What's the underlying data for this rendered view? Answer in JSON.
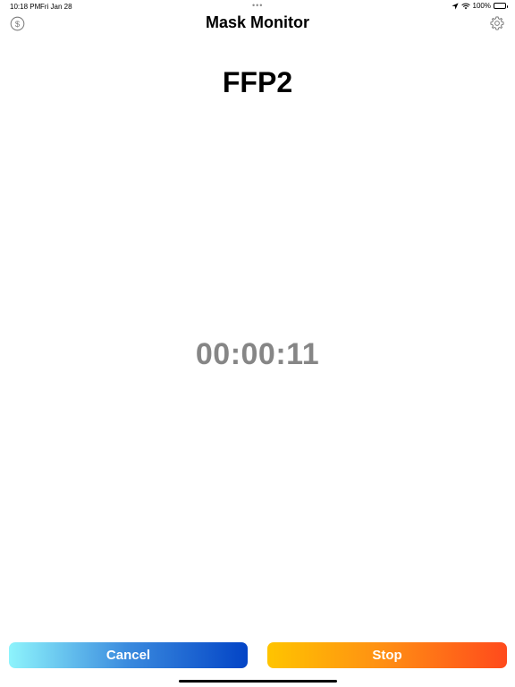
{
  "status_bar": {
    "time": "10:18 PM",
    "date": "Fri Jan 28",
    "multitask_indicator": "•••",
    "battery_percent": "100%",
    "icons": [
      "location-icon",
      "wifi-icon",
      "battery-icon"
    ]
  },
  "nav": {
    "title": "Mask Monitor",
    "left_icon": "dollar-circle-icon",
    "right_icon": "gear-icon"
  },
  "main": {
    "mask_type": "FFP2",
    "timer": "00:00:11"
  },
  "actions": {
    "cancel_label": "Cancel",
    "stop_label": "Stop"
  },
  "colors": {
    "cancel_gradient": [
      "#8ef4fc",
      "#0344c6"
    ],
    "stop_gradient": [
      "#ffc400",
      "#ff4a1c"
    ],
    "timer_text": "#868686"
  }
}
